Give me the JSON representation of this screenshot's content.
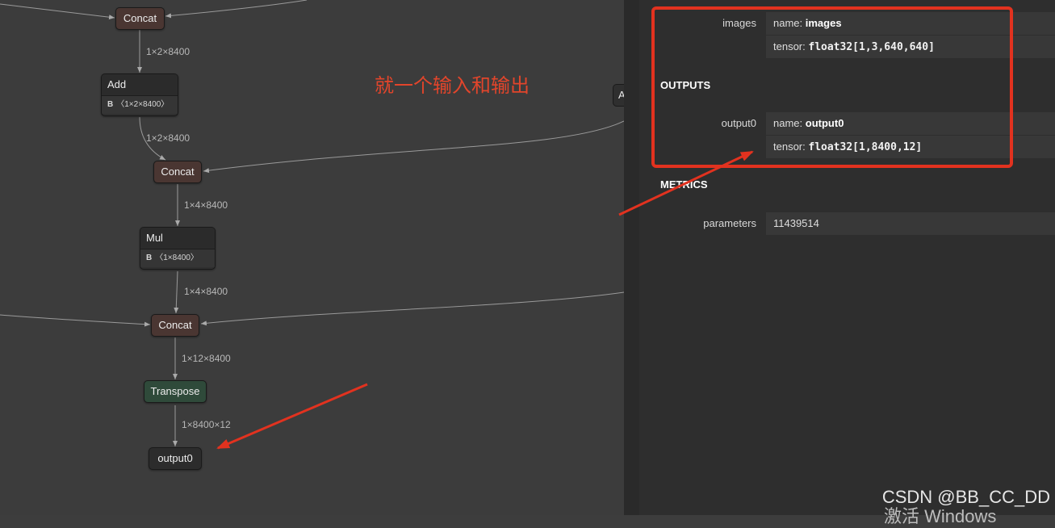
{
  "graph": {
    "nodes": {
      "concat_top": "Concat",
      "add": {
        "title": "Add",
        "attr_key": "B",
        "attr_value": "〈1×2×8400〉"
      },
      "concat_mid": "Concat",
      "mul": {
        "title": "Mul",
        "attr_key": "B",
        "attr_value": "〈1×8400〉"
      },
      "concat_low": "Concat",
      "transpose": "Transpose",
      "output": "output0",
      "partial": "A"
    },
    "edge_labels": [
      "1×2×8400",
      "1×2×8400",
      "1×4×8400",
      "1×4×8400",
      "1×12×8400",
      "1×8400×12"
    ]
  },
  "annotation": {
    "text": "就一个输入和输出",
    "color": "#e2452b"
  },
  "panel": {
    "inputs": [
      {
        "label": "images",
        "name_key": "name:",
        "name": "images",
        "tensor_key": "tensor:",
        "tensor": "float32[1,3,640,640]"
      }
    ],
    "outputs_title": "OUTPUTS",
    "outputs": [
      {
        "label": "output0",
        "name_key": "name:",
        "name": "output0",
        "tensor_key": "tensor:",
        "tensor": "float32[1,8400,12]"
      }
    ],
    "metrics_title": "METRICS",
    "metrics": [
      {
        "label": "parameters",
        "value": "11439514"
      }
    ]
  },
  "watermark": {
    "text": "CSDN @BB_CC_DD",
    "overlay": "激活 Windows"
  },
  "colors": {
    "highlight": "#e2321f",
    "concat": "#4a3632",
    "transpose": "#2f4a3a",
    "background": "#3c3c3c"
  }
}
